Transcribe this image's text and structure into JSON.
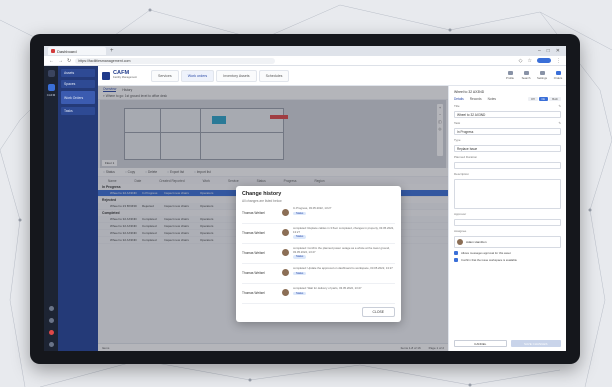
{
  "browser": {
    "tab_title": "Dashboard",
    "new_tab": "+",
    "url": "https://facilitiesmanagement.com"
  },
  "rail": {
    "app_label": "CAFM"
  },
  "sidepanel": {
    "items": [
      "Assets",
      "Spaces",
      "Work Orders",
      "Tasks"
    ]
  },
  "header": {
    "logo_text": "CAFM",
    "logo_sub": "Facility Management",
    "tabs": [
      "Services",
      "Work orders",
      "Inventory Assets",
      "Schedules"
    ],
    "active_tab": 1,
    "right_items": [
      "Profile",
      "Search",
      "Settings",
      "Orders"
    ]
  },
  "subtabs": [
    "Overview",
    "History"
  ],
  "breadcrumb": "Where to go: 1st ground level to office desk",
  "map": {
    "floor_label": "Floor 1"
  },
  "toolbar": [
    "Status",
    "Copy",
    "Delete",
    "Export list",
    "Import list"
  ],
  "table": {
    "columns": [
      "Name",
      "Date",
      "Created Reported",
      "Work",
      "Service",
      "Status",
      "Progress",
      "Region"
    ],
    "groups": [
      {
        "label": "In Progress",
        "rows": [
          [
            "Wheel to 32 AX3ND",
            "In Progress",
            "Inspect new chairs",
            "Operators",
            "Electrical",
            "2 Open",
            "Branch 4",
            "Region 4th"
          ]
        ]
      },
      {
        "label": "Rejected",
        "rows": [
          [
            "Wheel to 23 BX3ND",
            "Rejected",
            "Inspect new chairs",
            "Operators",
            "Electrical",
            "1 Open",
            "Branch 2",
            "Region 4th"
          ]
        ]
      },
      {
        "label": "Completed",
        "rows": [
          [
            "Wheel to 32 AX3ND",
            "Completed",
            "Inspect new chairs",
            "Operators",
            "Electrical",
            "2 Done",
            "Branch 4",
            "Region 4th"
          ],
          [
            "Wheel to 32 AX3ND",
            "Completed",
            "Inspect new chairs",
            "Operators",
            "Electrical",
            "2 Done",
            "Branch 4",
            "Region 4th"
          ],
          [
            "Wheel to 32 AX3ND",
            "Completed",
            "Inspect new chairs",
            "Operators",
            "Electrical",
            "2 Done",
            "Branch 4",
            "Region 4th"
          ],
          [
            "Wheel to 32 AX3ND",
            "Completed",
            "Inspect new chairs",
            "Operators",
            "Electrical",
            "2 Done",
            "Branch 4",
            "Region 4th"
          ]
        ]
      }
    ]
  },
  "footer": {
    "left": "Items",
    "right": [
      "Items 1-8 of 16",
      "Page 1 of 2"
    ]
  },
  "dialog": {
    "title": "Change history",
    "subtitle": "All changes are listed below",
    "entries": [
      {
        "who": "Thomas Weitzel",
        "text": "In Progress, 03.05.2022, 13:27",
        "chip": "Status"
      },
      {
        "who": "Thomas Weitzel",
        "text": "completed: Replace cables in 3 floor completed, changes in property, 03.05.2022, 13:27",
        "chip": "Status"
      },
      {
        "who": "Thomas Weitzel",
        "text": "completed: Confirm the planned power outage as a whole at the lower ground, 03.05.2022, 13:27",
        "chip": "Status"
      },
      {
        "who": "Thomas Weitzel",
        "text": "completed: Update the approved on dashboard to workspace, 03.05.2022, 13:27",
        "chip": "Status"
      },
      {
        "who": "Thomas Weitzel",
        "text": "completed: Wait for delivery of parts, 03.05.2022, 13:27",
        "chip": "Status"
      }
    ],
    "close_label": "CLOSE"
  },
  "detail": {
    "title": "Wheel to 32 AX3ND",
    "tabs": [
      "Details",
      "Records",
      "Notes"
    ],
    "segments": [
      "Off",
      "On",
      "Both"
    ],
    "fields": [
      {
        "label": "Title",
        "value": "Wheel to 32 AX3ND"
      },
      {
        "label": "Task",
        "value": "In Progress"
      },
      {
        "label": "Type",
        "value": "Replace Issue"
      }
    ],
    "schedule_label": "Planned Duration",
    "description_label": "Description",
    "description_placeholder": "",
    "approver_label": "Approver",
    "assignee_label": "Assignee",
    "assignee_name": "Adam Hamilton",
    "checks": [
      "Allows messages approval for this asset",
      "Confirm that the issue workspace is available"
    ],
    "cancel_label": "CANCEL",
    "save_label": "SAVE CHANGES"
  }
}
